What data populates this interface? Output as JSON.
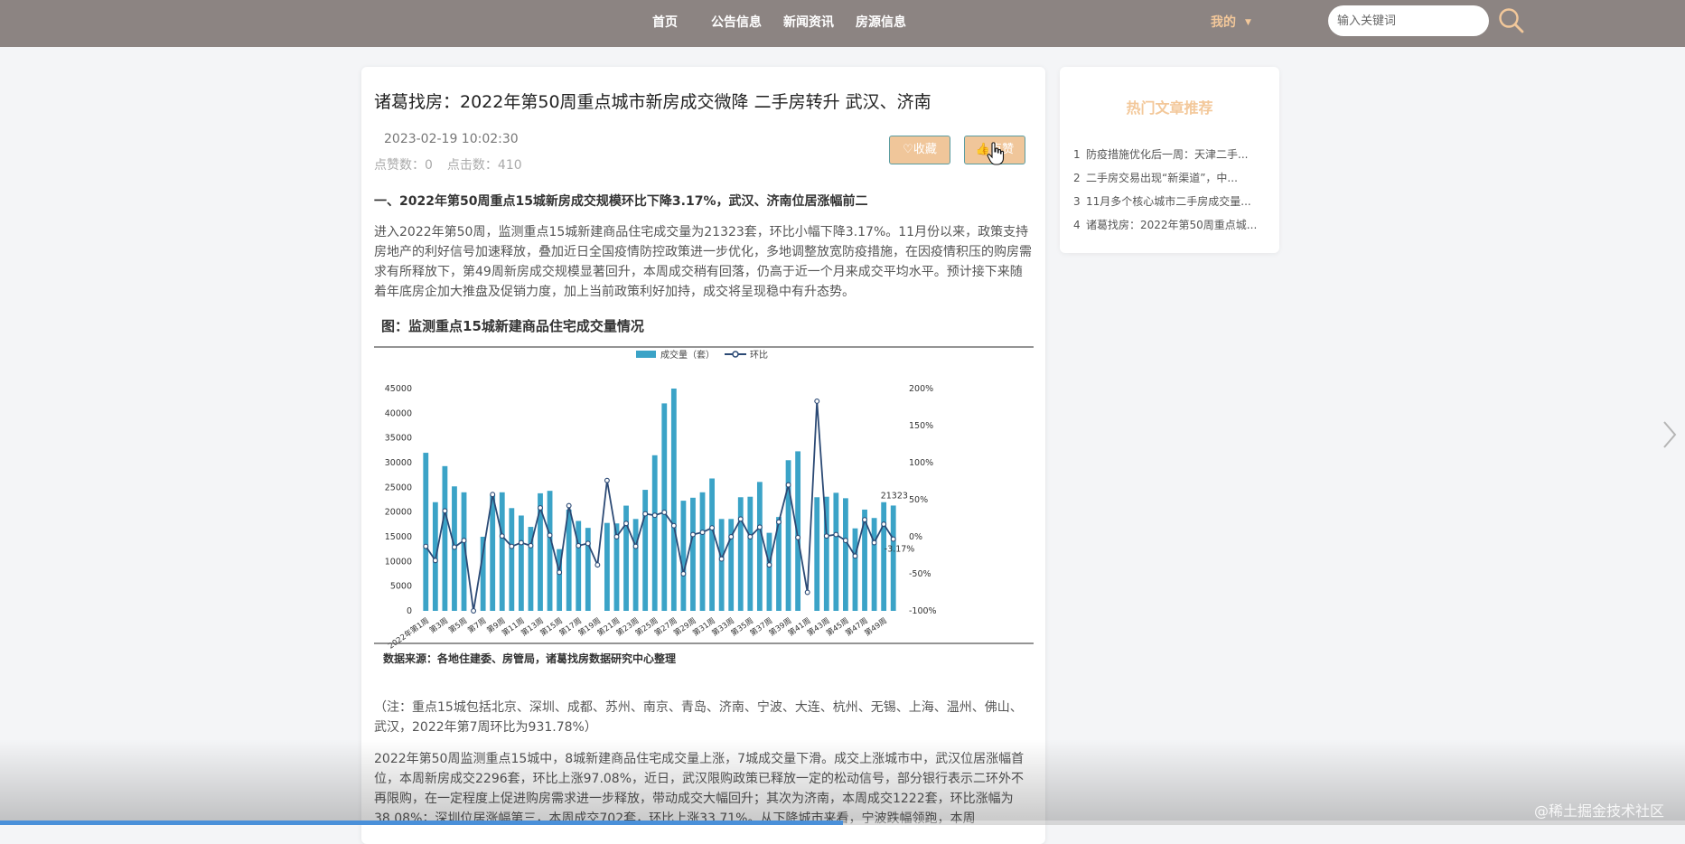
{
  "nav": {
    "home": "首页",
    "notices": "公告信息",
    "news": "新闻资讯",
    "houses": "房源信息",
    "user_menu": "我的"
  },
  "search": {
    "placeholder": "输入关键词"
  },
  "article": {
    "title": "诸葛找房：2022年第50周重点城市新房成交微降 二手房转升 武汉、济南",
    "time": "2023-02-19 10:02:30",
    "likes_label": "点赞数：",
    "likes": "0",
    "clicks_label": "点击数：",
    "clicks": "410",
    "favorite_label": "♡收藏",
    "like_label": "点赞",
    "section_heading": "一、2022年第50周重点15城新房成交规模环比下降3.17%，武汉、济南位居涨幅前二",
    "paragraph1": "进入2022年第50周，监测重点15城新建商品住宅成交量为21323套，环比小幅下降3.17%。11月份以来，政策支持房地产的利好信号加速释放，叠加近日全国疫情防控政策进一步优化，多地调整放宽防疫措施，在因疫情积压的购房需求有所释放下，第49周新房成交规模显著回升，本周成交稍有回落，仍高于近一个月来成交平均水平。预计接下来随着年底房企加大推盘及促销力度，加上当前政策利好加持，成交将呈现稳中有升态势。",
    "note": "（注：重点15城包括北京、深圳、成都、苏州、南京、青岛、济南、宁波、大连、杭州、无锡、上海、温州、佛山、武汉，2022年第7周环比为931.78%）",
    "paragraph2": "2022年第50周监测重点15城中，8城新建商品住宅成交量上涨，7城成交量下滑。成交上涨城市中，武汉位居涨幅首位，本周新房成交2296套，环比上涨97.08%，近日，武汉限购政策已释放一定的松动信号，部分银行表示二环外不再限购，在一定程度上促进购房需求进一步释放，带动成交大幅回升；其次为济南，本周成交1222套，环比涨幅为38.08%；深圳位居涨幅第三，本周成交702套，环比上涨33.71%。从下降城市来看，宁波跌幅领跑，本周"
  },
  "chart_data": {
    "type": "bar",
    "title": "图：监测重点15城新建商品住宅成交量情况",
    "source": "数据来源：各地住建委、房管局，诸葛找房数据研究中心整理",
    "legend": [
      "成交量（套）",
      "环比"
    ],
    "y_ticks": [
      "45000",
      "40000",
      "35000",
      "30000",
      "25000",
      "20000",
      "15000",
      "10000",
      "5000",
      "0"
    ],
    "y2_ticks": [
      "200%",
      "150%",
      "100%",
      "50%",
      "0%",
      "-50%",
      "-100%"
    ],
    "x_tick_labels": [
      "2022年第1周",
      "第3周",
      "第5周",
      "第7周",
      "第9周",
      "第11周",
      "第13周",
      "第15周",
      "第17周",
      "第19周",
      "第21周",
      "第23周",
      "第25周",
      "第27周",
      "第29周",
      "第31周",
      "第33周",
      "第35周",
      "第37周",
      "第39周",
      "第41周",
      "第43周",
      "第45周",
      "第47周",
      "第49周"
    ],
    "ylim": [
      0,
      45000
    ],
    "y2lim": [
      -100,
      200
    ],
    "bar_color": "#3ba3c7",
    "line_color": "#2c4a75",
    "series": [
      {
        "name": "成交量（套）",
        "values": [
          32000,
          22000,
          29300,
          25200,
          24000,
          0,
          15000,
          23500,
          24000,
          20800,
          19300,
          17000,
          23800,
          24300,
          12500,
          20500,
          18200,
          16800,
          0,
          17800,
          17700,
          21300,
          18600,
          24500,
          31500,
          42000,
          45000,
          22300,
          22900,
          24000,
          26800,
          18600,
          18600,
          23000,
          23100,
          26100,
          15800,
          19000,
          30500,
          32300,
          0,
          23000,
          23100,
          23900,
          22800,
          16700,
          20500,
          18800,
          22000,
          21323
        ]
      },
      {
        "name": "环比",
        "values": [
          -13,
          -32,
          35,
          -14,
          -5,
          -100,
          null,
          57,
          1,
          -13,
          -8,
          -12,
          39,
          2,
          -48,
          42,
          -12,
          -9,
          -38,
          76,
          0,
          18,
          -13,
          31,
          29,
          33,
          15,
          -50,
          3,
          6,
          12,
          -30,
          0,
          24,
          0,
          13,
          -38,
          20,
          70,
          -1,
          -75,
          183,
          1,
          3,
          -5,
          -26,
          23,
          -8,
          17,
          -3.17
        ]
      }
    ],
    "annotations": [
      "21323",
      "-3.17%"
    ]
  },
  "sidebar": {
    "title": "热门文章推荐",
    "items": [
      {
        "num": "1",
        "label": "防疫措施优化后一周：天津二手..."
      },
      {
        "num": "2",
        "label": "二手房交易出现“新渠道”，中..."
      },
      {
        "num": "3",
        "label": "11月多个核心城市二手房成交量..."
      },
      {
        "num": "4",
        "label": "诸葛找房：2022年第50周重点城..."
      }
    ]
  },
  "video": {
    "progress": 0.5
  },
  "watermark": "@稀土掘金技术社区",
  "colors": {
    "topbar": "#8c8482",
    "accent": "#f3c89a",
    "button_fill": "#f0c69a",
    "button_border": "#5a9ca0"
  },
  "icons": {
    "search": "search-icon",
    "next": "chevron-right-icon",
    "cursor": "hand-cursor-icon"
  }
}
